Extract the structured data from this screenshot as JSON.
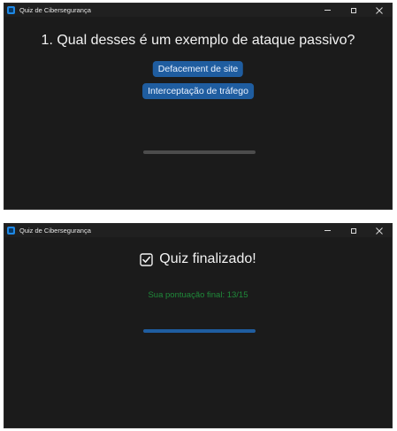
{
  "window": {
    "title": "Quiz de Cibersegurança",
    "controls": {
      "minimize": "minimize-icon",
      "maximize": "maximize-icon",
      "close": "close-icon"
    }
  },
  "screen_question": {
    "question": "1. Qual desses é um exemplo de ataque passivo?",
    "answers": [
      "Defacement de site",
      "Interceptação de tráfego"
    ],
    "progress": 0.0
  },
  "screen_finished": {
    "title": "Quiz finalizado!",
    "title_icon": "checkbox-checked-icon",
    "score_text": "Sua pontuação final: 13/15",
    "progress": 1.0
  },
  "colors": {
    "background": "#1b1b1b",
    "accent": "#1f5da0",
    "success": "#1f8a3a",
    "track": "#4c4c4c"
  }
}
